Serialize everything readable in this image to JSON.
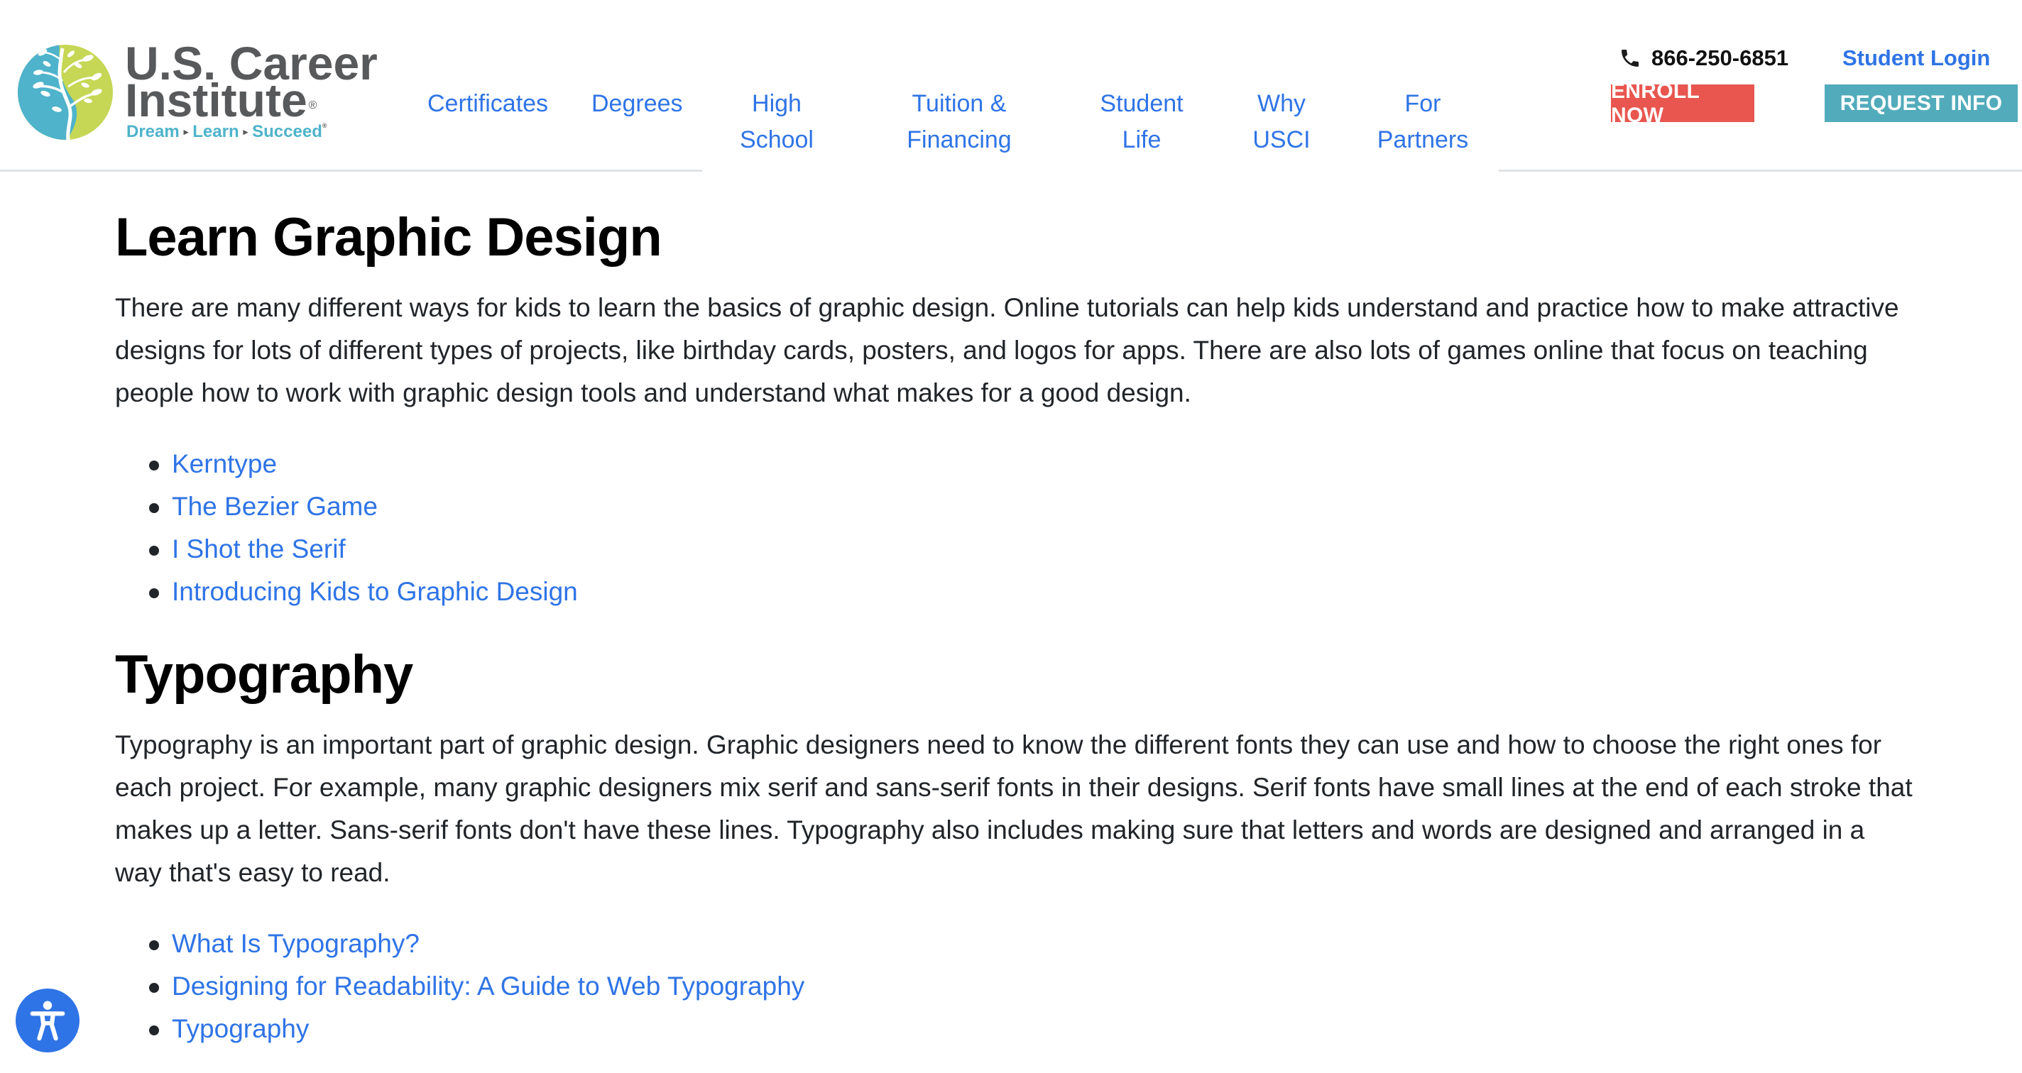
{
  "header": {
    "logo": {
      "line1": "U.S. Career",
      "line2": "Institute",
      "registered": "®",
      "tagline": [
        "Dream",
        "Learn",
        "Succeed"
      ],
      "tagline_sep": "▸",
      "tagline_reg": "®",
      "colors": {
        "teal": "#4EB3CB",
        "green": "#C5D754",
        "gray": "#58595B"
      }
    },
    "nav": [
      {
        "label": "Certificates"
      },
      {
        "label": "Degrees"
      },
      {
        "label": "High School",
        "lines": [
          "High",
          "School"
        ]
      },
      {
        "label": "Tuition & Financing",
        "lines": [
          "Tuition &",
          "Financing"
        ]
      },
      {
        "label": "Student Life",
        "lines": [
          "Student",
          "Life"
        ]
      },
      {
        "label": "Why USCI",
        "lines": [
          "Why",
          "USCI"
        ]
      },
      {
        "label": "For Partners",
        "lines": [
          "For",
          "Partners"
        ]
      }
    ],
    "phone": {
      "icon": "phone-icon",
      "number": "866-250-6851"
    },
    "student_login": "Student Login",
    "enroll_button": {
      "label": "ENROLL NOW",
      "color": "#E8564F"
    },
    "request_button": {
      "label": "REQUEST INFO",
      "color": "#52ABBB"
    }
  },
  "main": {
    "sections": [
      {
        "heading": "Learn Graphic Design",
        "paragraph": "There are many different ways for kids to learn the basics of graphic design. Online tutorials can help kids understand and practice how to make attractive designs for lots of different types of projects, like birthday cards, posters, and logos for apps. There are also lots of games online that focus on teaching people how to work with graphic design tools and understand what makes for a good design.",
        "links": [
          "Kerntype",
          "The Bezier Game",
          "I Shot the Serif",
          "Introducing Kids to Graphic Design"
        ]
      },
      {
        "heading": "Typography",
        "paragraph": "Typography is an important part of graphic design. Graphic designers need to know the different fonts they can use and how to choose the right ones for each project. For example, many graphic designers mix serif and sans-serif fonts in their designs. Serif fonts have small lines at the end of each stroke that makes up a letter. Sans-serif fonts don't have these lines. Typography also includes making sure that letters and words are designed and arranged in a way that's easy to read.",
        "links": [
          "What Is Typography?",
          "Designing for Readability: A Guide to Web Typography",
          "Typography"
        ]
      }
    ]
  },
  "accessibility_widget": {
    "icon": "accessibility-icon",
    "color": "#2F74E6"
  },
  "colors": {
    "link": "#2F74E6",
    "text": "#212529",
    "heading": "#000000",
    "header_border": "#E1E3E6"
  }
}
